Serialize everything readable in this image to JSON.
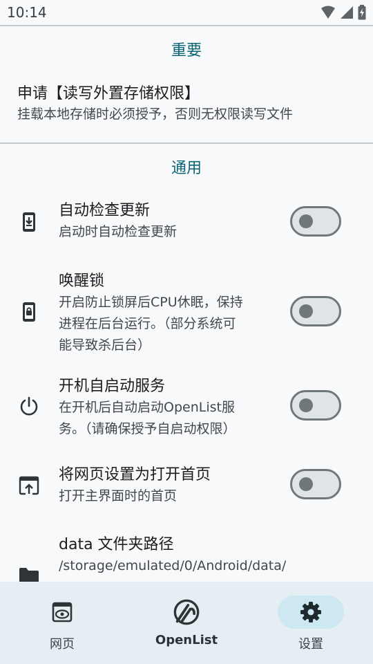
{
  "status_bar": {
    "time": "10:14"
  },
  "sections": {
    "important": {
      "title": "重要",
      "items": [
        {
          "title": "申请【读写外置存储权限】",
          "subtitle": "挂载本地存储时必须授予，否则无权限读写文件"
        }
      ]
    },
    "general": {
      "title": "通用",
      "items": [
        {
          "title": "自动检查更新",
          "subtitle_lines": [
            "启动时自动检查更新"
          ],
          "icon": "system-update-icon",
          "enabled": false
        },
        {
          "title": "唤醒锁",
          "subtitle_lines": [
            "开启防止锁屏后CPU休眠，保持",
            "进程在后台运行。（部分系统可",
            "能导致杀后台）"
          ],
          "icon": "phone-lock-icon",
          "enabled": false
        },
        {
          "title": "开机自启动服务",
          "subtitle_lines": [
            "在开机后自动启动OpenList服",
            "务。（请确保授予自启动权限）"
          ],
          "icon": "power-icon",
          "enabled": false
        },
        {
          "title": "将网页设置为打开首页",
          "subtitle_lines": [
            "打开主界面时的首页"
          ],
          "icon": "open-in-browser-icon",
          "enabled": false
        },
        {
          "title": "data 文件夹路径",
          "subtitle_lines": [
            "/storage/emulated/0/Android/data/"
          ],
          "icon": "folder-icon"
        }
      ]
    }
  },
  "bottom_nav": {
    "items": [
      {
        "label": "网页",
        "icon": "web-preview-icon",
        "active": false
      },
      {
        "label": "OpenList",
        "icon": "openlist-logo-icon",
        "active": false
      },
      {
        "label": "设置",
        "icon": "gear-icon",
        "active": true
      }
    ]
  },
  "colors": {
    "accent": "#0b6374",
    "nav_background": "#e5eef2",
    "active_pill": "#cde8f1",
    "switch_off": "#70777b"
  }
}
